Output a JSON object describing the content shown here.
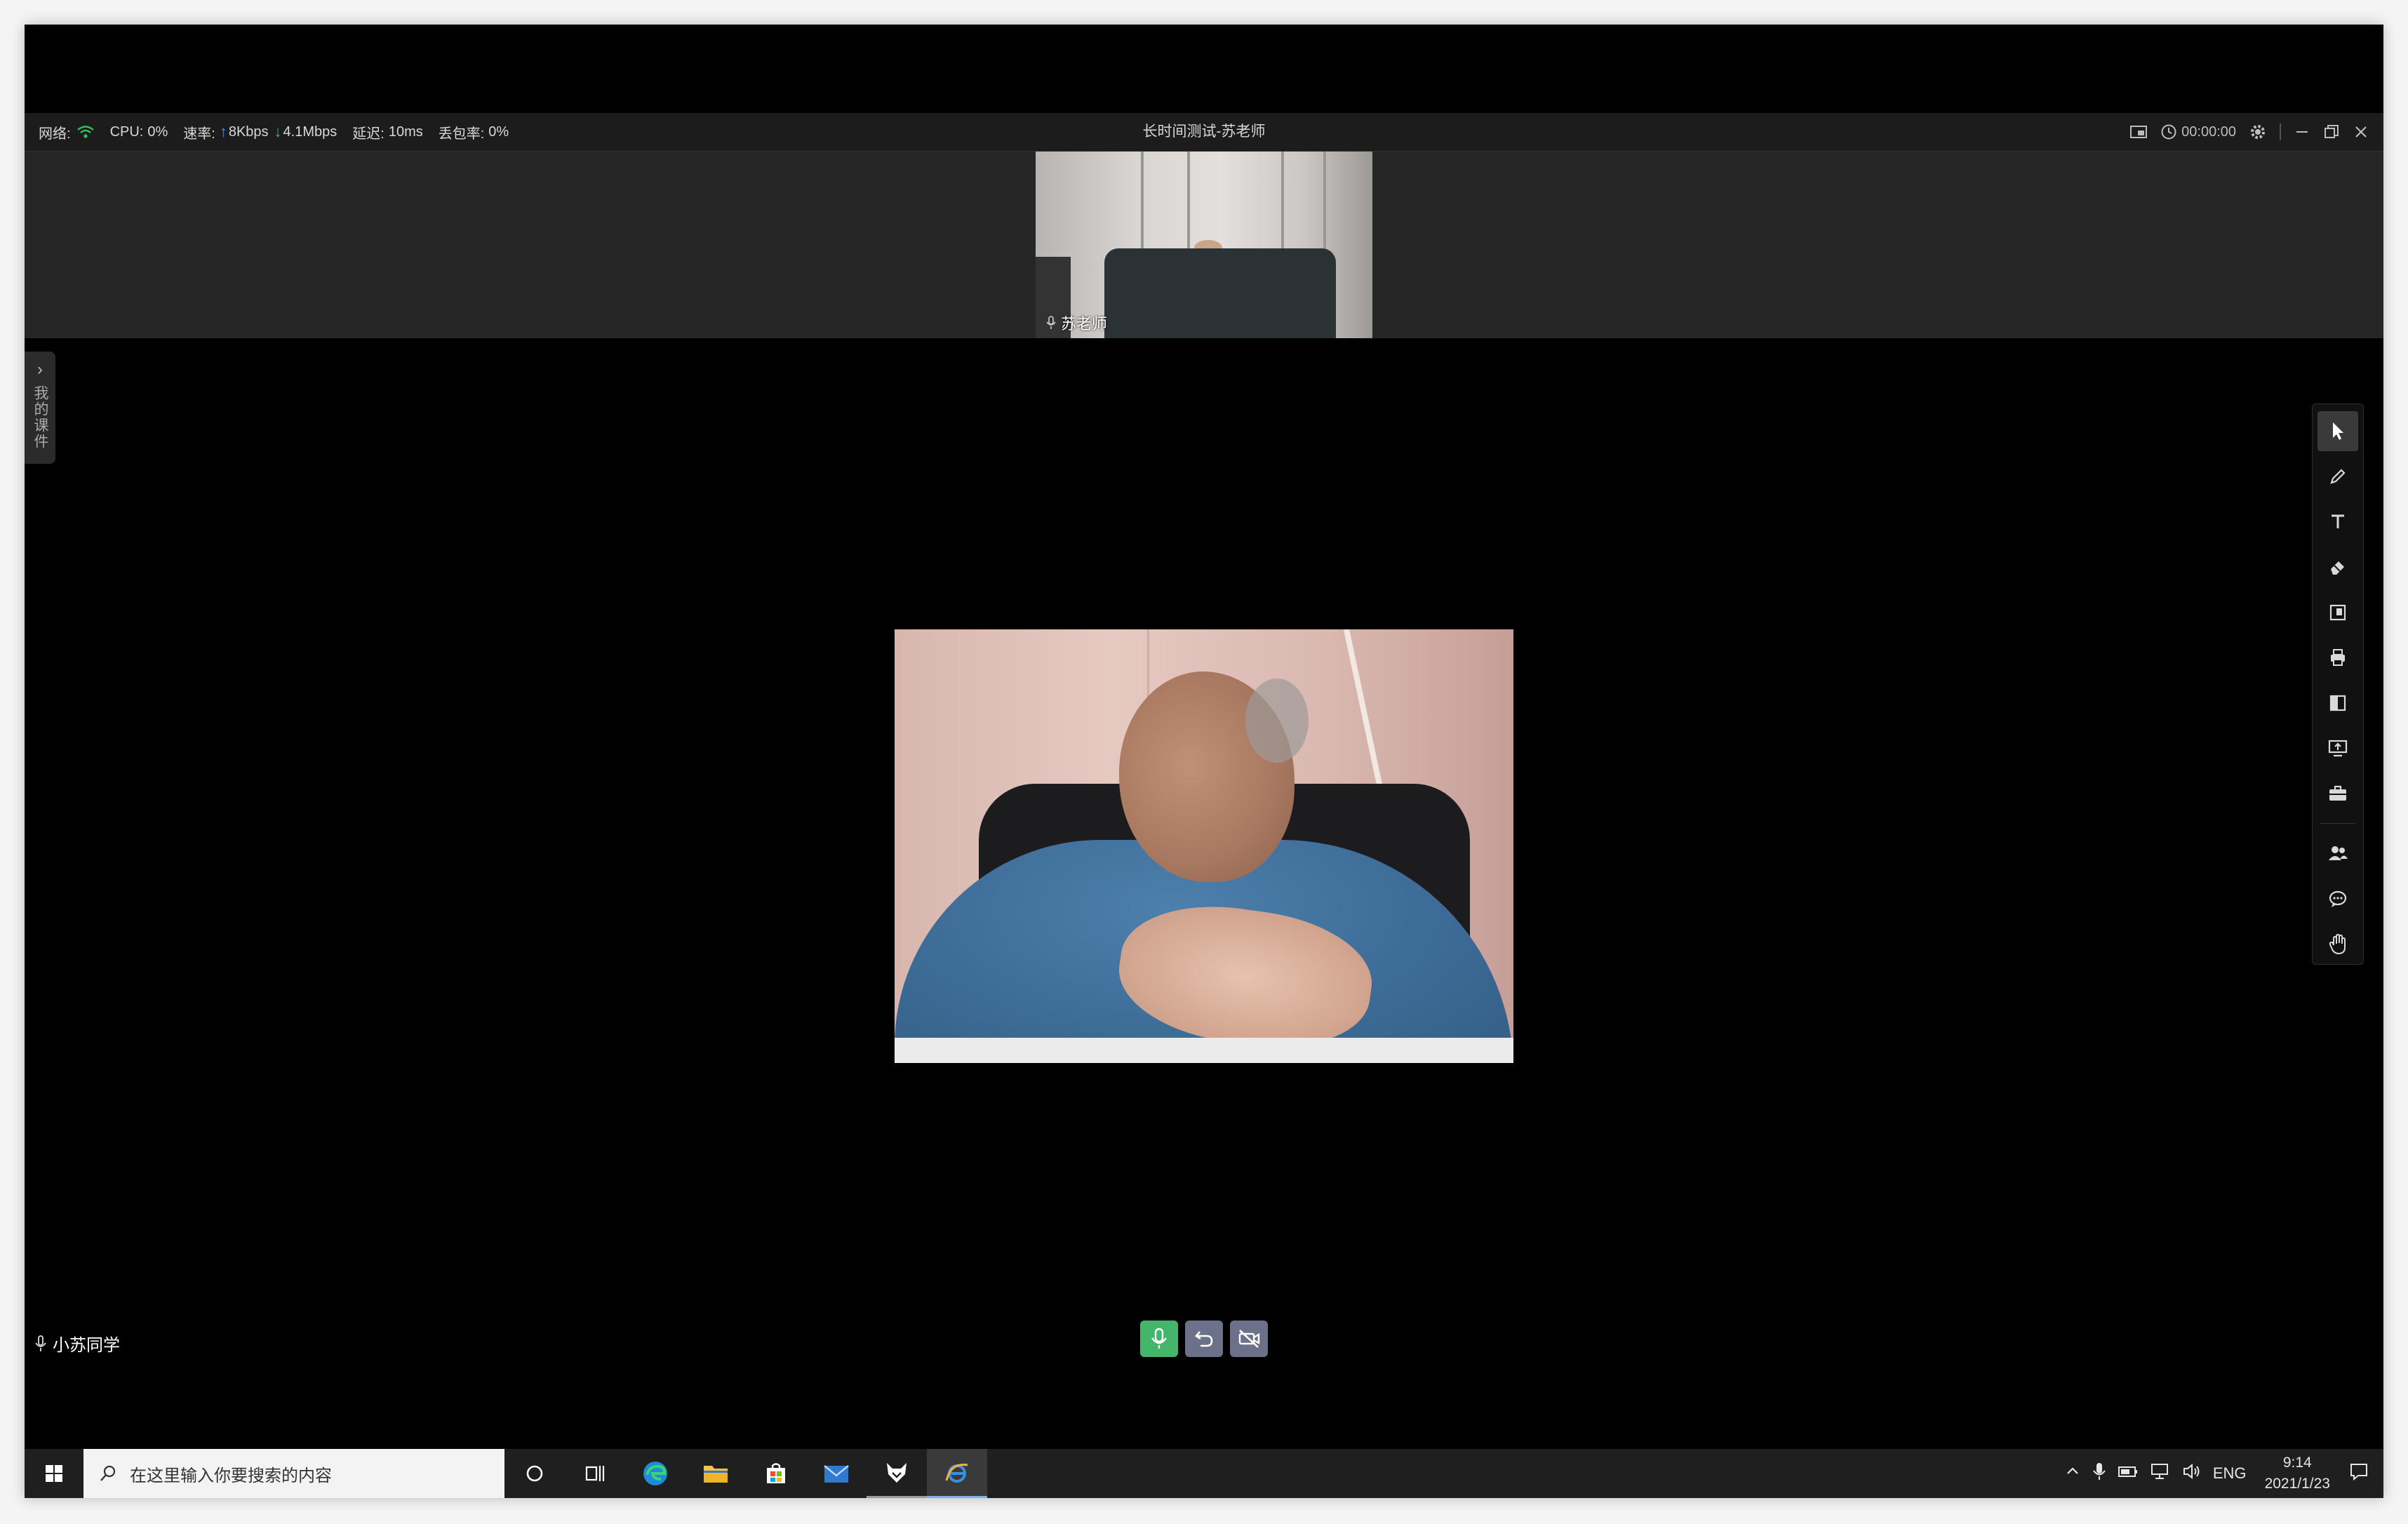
{
  "status_bar": {
    "network_label": "网络:",
    "cpu_label": "CPU:",
    "cpu_value": "0%",
    "speed_label": "速率:",
    "upload": "8Kbps",
    "download": "4.1Mbps",
    "latency_label": "延迟:",
    "latency_value": "10ms",
    "loss_label": "丢包率:",
    "loss_value": "0%"
  },
  "window": {
    "title": "长时间测试-苏老师",
    "timer": "00:00:00"
  },
  "teacher_thumb": {
    "name": "苏老师"
  },
  "courseware_tab": {
    "label": "我的课件"
  },
  "student_label": {
    "name": "小苏同学"
  },
  "toolbar": {
    "tools": [
      "cursor-icon",
      "pen-icon",
      "text-icon",
      "eraser-icon",
      "courseware-icon",
      "print-icon",
      "document-icon",
      "share-screen-icon",
      "toolbox-icon",
      "users-icon",
      "chat-icon",
      "raise-hand-icon"
    ]
  },
  "bottom_controls": [
    "microphone-icon",
    "undo-icon",
    "camera-off-icon"
  ],
  "taskbar": {
    "search_placeholder": "在这里输入你要搜索的内容",
    "language": "ENG",
    "time": "9:14",
    "date": "2021/1/23"
  },
  "colors": {
    "mic_button": "#44b66c",
    "control_button": "#6a7189",
    "upload_arrow": "#2f8cff",
    "download_arrow": "#3dbb5c"
  }
}
